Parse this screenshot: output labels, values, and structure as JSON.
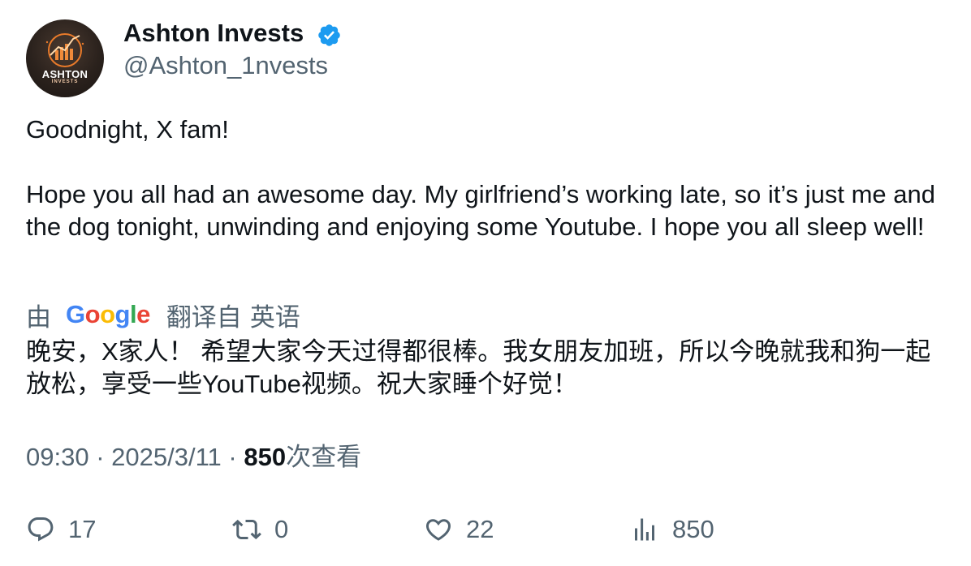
{
  "author": {
    "display_name": "Ashton Invests",
    "handle": "@Ashton_1nvests",
    "avatar_text": "ASHTON",
    "avatar_subtext": "INVESTS",
    "verified_icon": "verified-badge-icon"
  },
  "tweet": {
    "text": "Goodnight, X fam!\n\nHope you all had an awesome day. My girlfriend’s working late, so it’s just me and the dog tonight, unwinding and enjoying some Youtube. I hope you all sleep well!"
  },
  "translation": {
    "prefix": "由",
    "provider": "Google",
    "label": "翻译自",
    "language": "英语",
    "text": "晚安，X家人！ 希望大家今天过得都很棒。我女朋友加班，所以今晚就我和狗一起放松，享受一些YouTube视频。祝大家睡个好觉！"
  },
  "meta": {
    "time": "09:30",
    "separator": "·",
    "date": "2025/3/11",
    "views_count": "850",
    "views_label": "次查看"
  },
  "actions": {
    "replies": "17",
    "reposts": "0",
    "likes": "22",
    "views": "850"
  },
  "colors": {
    "text": "#0f1419",
    "secondary": "#536471",
    "verified": "#1d9bf0",
    "avatar_accent": "#e87a2a"
  }
}
